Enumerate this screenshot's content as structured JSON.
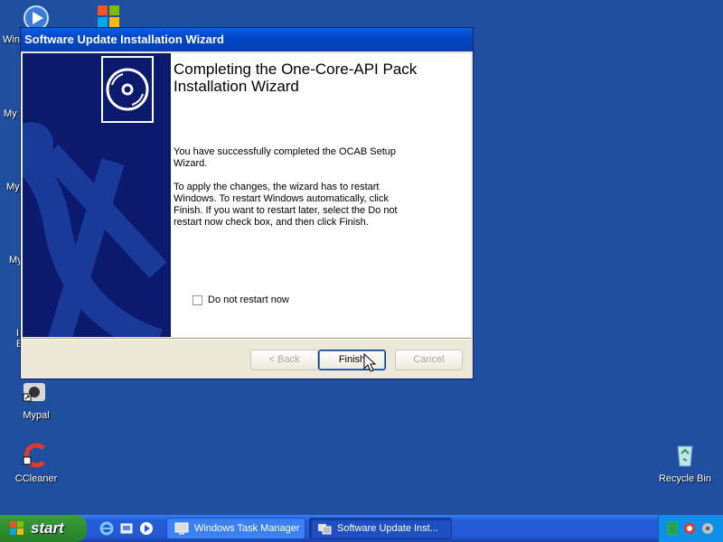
{
  "desktop": {
    "icons": [
      {
        "label": "Wind"
      },
      {
        "label": "Mypal"
      },
      {
        "label": "CCleaner"
      },
      {
        "label": "Recycle Bin"
      }
    ],
    "partial_labels": [
      "My",
      "My",
      "My",
      "I",
      "E"
    ]
  },
  "wizard": {
    "title": "Software Update Installation Wizard",
    "heading": "Completing the One-Core-API Pack Installation Wizard",
    "paragraph1": "You have successfully completed the OCAB Setup Wizard.",
    "paragraph2": "To apply the changes, the wizard has to restart Windows. To restart Windows automatically, click Finish. If you want to restart later, select the Do not restart now check box, and then click Finish.",
    "checkbox_label": "Do not restart now",
    "checkbox_checked": false,
    "buttons": {
      "back": "< Back",
      "finish": "Finish",
      "cancel": "Cancel"
    }
  },
  "taskbar": {
    "start_label": "start",
    "tasks": [
      {
        "label": "Windows Task Manager"
      },
      {
        "label": "Software Update Inst..."
      }
    ]
  },
  "colors": {
    "desktop_bg": "#1f4f9e",
    "title_bar": "#0a5fe0",
    "sidebar": "#0b1a6c",
    "taskbar": "#245edb",
    "start_button": "#2f8e2f"
  }
}
